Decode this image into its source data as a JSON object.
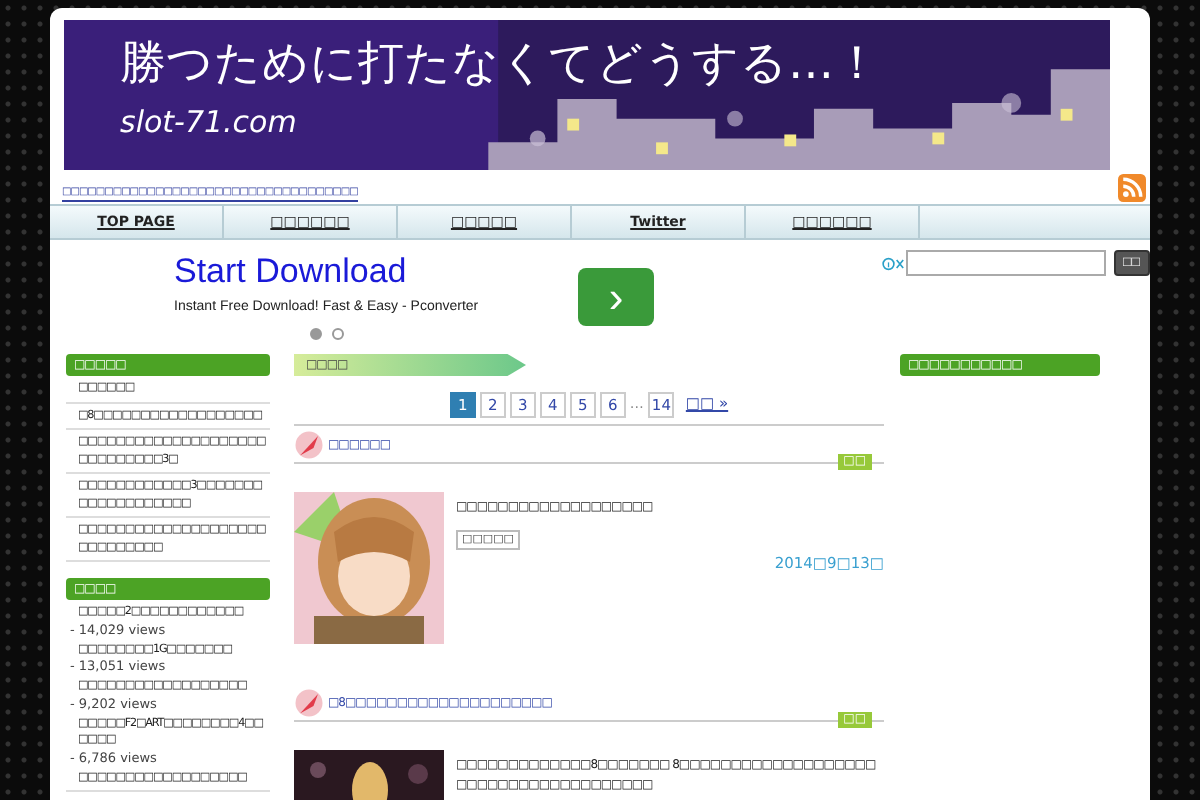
{
  "header": {
    "title": "勝つために打たなくてどうする…！",
    "url": "slot-71.com",
    "tagline": "□□□□□□□□□□□□□□□□□□□□□□□□□□□□□□□□□□□"
  },
  "nav": [
    {
      "label": "TOP PAGE"
    },
    {
      "label": "□□□□□□"
    },
    {
      "label": "□□□□□"
    },
    {
      "label": "Twitter"
    },
    {
      "label": "□□□□□□"
    }
  ],
  "ad": {
    "title": "Start Download",
    "subtitle": "Instant Free Download! Fast & Easy - Pconverter",
    "arrow": "›",
    "dots": [
      {
        "selected": true
      },
      {
        "selected": false
      }
    ]
  },
  "search": {
    "button": "□□"
  },
  "left_sidebar": [
    {
      "heading": "□□□□□",
      "items": [
        {
          "text": "□□□□□□"
        },
        {
          "text": "□8□□□□□□□□□□□□□□□□□□"
        },
        {
          "text": "□□□□□□□□□□□□□□□□□□□□□□□□□□□□□3□"
        },
        {
          "text": "□□□□□□□□□□□□3□□□□□□□□□□□□□□□□□□□"
        },
        {
          "text": "□□□□□□□□□□□□□□□□□□□□□□□□□□□□□"
        }
      ]
    },
    {
      "heading": "□□□□",
      "items": [
        {
          "text": "□□□□□2□□□□□□□□□□□□",
          "views": "- 14,029 views"
        },
        {
          "text": "□□□□□□□□1G□□□□□□□",
          "views": "- 13,051 views"
        },
        {
          "text": "□□□□□□□□□□□□□□□□□□",
          "views": "- 9,202 views"
        },
        {
          "text": "□□□□□F2□ART□□□□□□□□4□□□□□□",
          "views": "- 6,786 views"
        },
        {
          "text": "□□□□□□□□□□□□□□□□□□"
        }
      ]
    }
  ],
  "main": {
    "section": "□□□□",
    "pagination": [
      {
        "label": "1",
        "selected": true
      },
      {
        "label": "2",
        "selected": false
      },
      {
        "label": "3",
        "selected": false
      },
      {
        "label": "4",
        "selected": false
      },
      {
        "label": "5",
        "selected": false
      },
      {
        "label": "6",
        "selected": false
      },
      {
        "label": "…",
        "kind": "gap"
      },
      {
        "label": "14",
        "selected": false
      },
      {
        "label": "□□ »",
        "kind": "next"
      }
    ],
    "posts": [
      {
        "title": "□□□□□□",
        "category": "□□",
        "excerpt": "□□□□□□□□□□□□□□□□□□□",
        "tag": "□□□□□",
        "date": "2014□9□13□"
      },
      {
        "title": "□8□□□□□□□□□□□□□□□□□□□□",
        "category": "□□",
        "excerpt": "□□□□□□□□□□□□□8□□□□□□□ 8□□□□□□□□□□□□□□□□□□□□□□□□□□□□□□□□□□□□□□"
      }
    ]
  },
  "right_sidebar": {
    "heading": "□□□□□□□□□□□"
  }
}
